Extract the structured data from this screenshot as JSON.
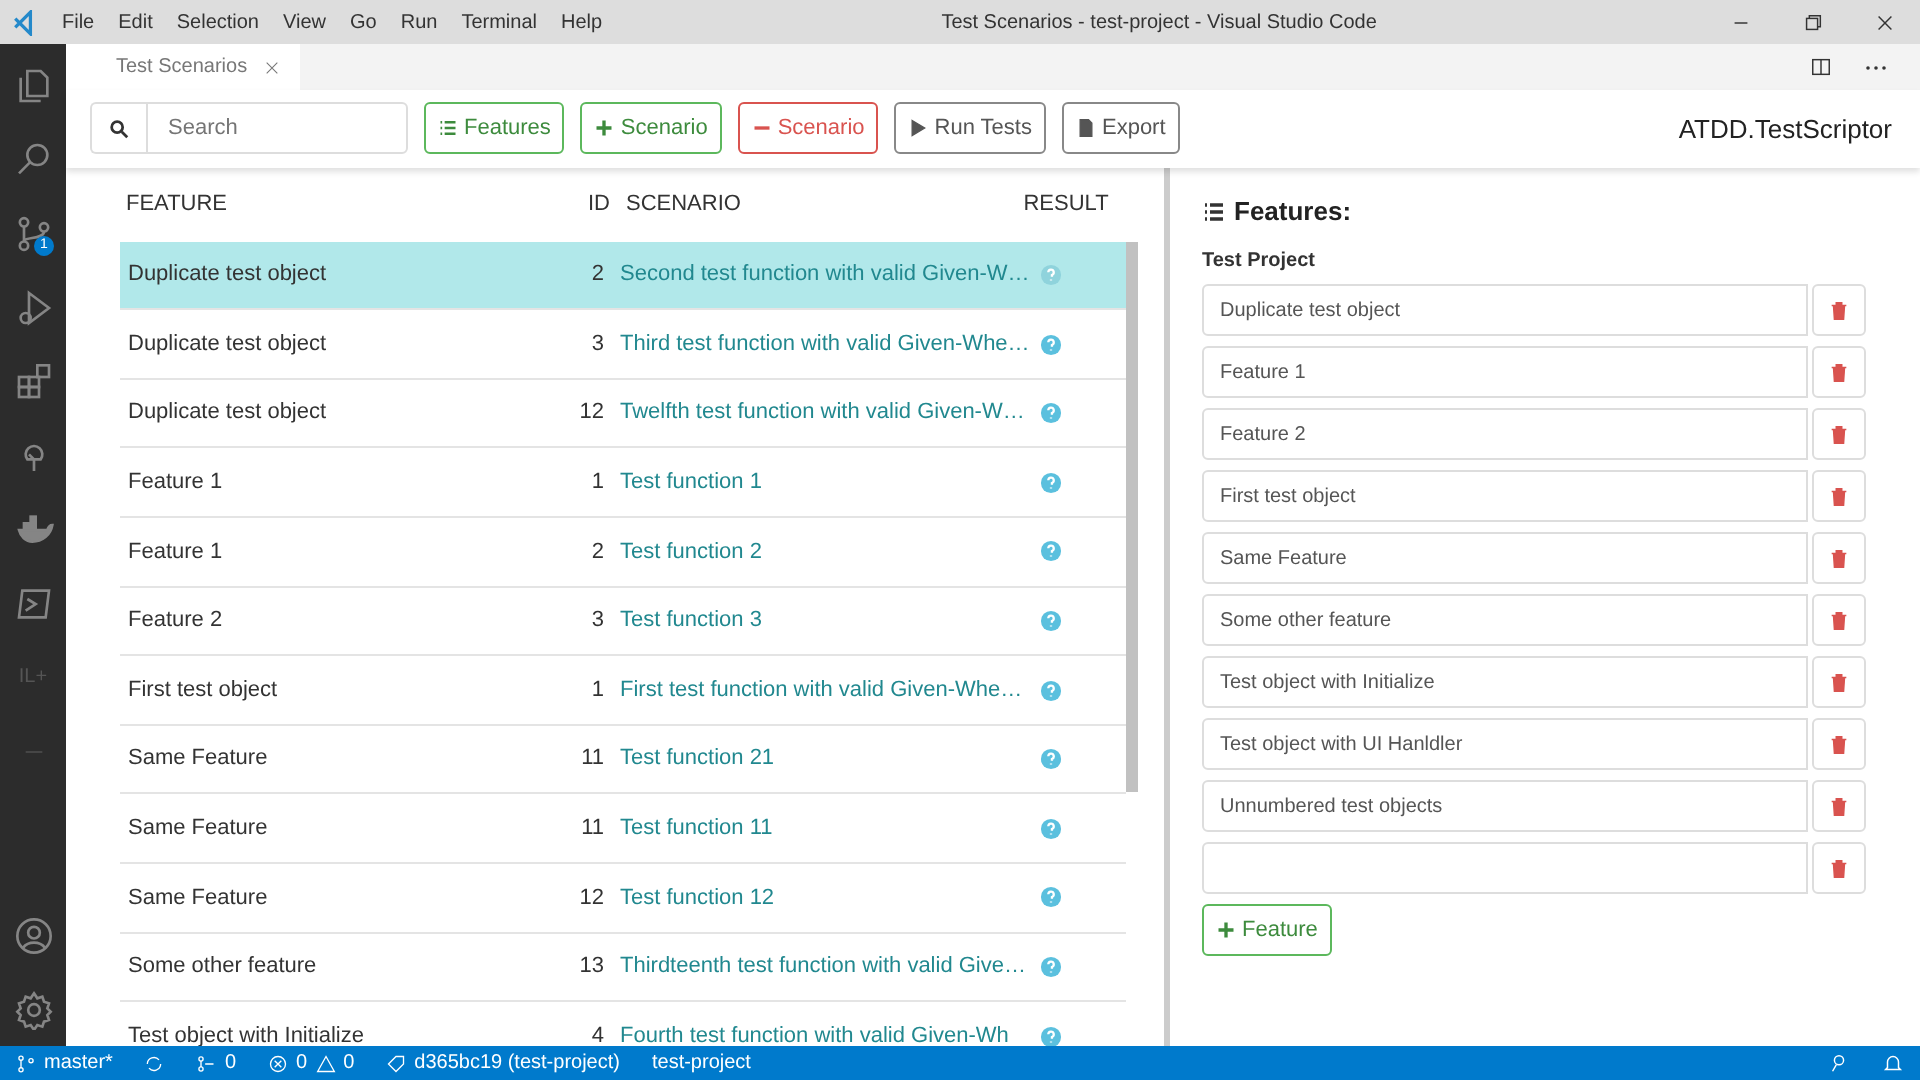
{
  "window": {
    "title": "Test Scenarios - test-project - Visual Studio Code",
    "menu": [
      "File",
      "Edit",
      "Selection",
      "View",
      "Go",
      "Run",
      "Terminal",
      "Help"
    ]
  },
  "activity_bar": {
    "source_control_badge": "1",
    "extension_label": "IL+"
  },
  "editor_tab": {
    "label": "Test Scenarios"
  },
  "toolbar": {
    "search": {
      "placeholder": "Search"
    },
    "buttons": [
      {
        "kind": "features",
        "label": "Features"
      },
      {
        "kind": "add",
        "label": "Scenario"
      },
      {
        "kind": "remove",
        "label": "Scenario"
      },
      {
        "kind": "run",
        "label": "Run Tests"
      },
      {
        "kind": "export",
        "label": "Export"
      }
    ],
    "brand": "ATDD.TestScriptor"
  },
  "table": {
    "columns": [
      "FEATURE",
      "ID",
      "SCENARIO",
      "RESULT"
    ],
    "rows": [
      {
        "feature": "Duplicate test object",
        "id": "2",
        "scenario": "Second test function with valid Given-W…",
        "selected": true
      },
      {
        "feature": "Duplicate test object",
        "id": "3",
        "scenario": "Third test function with valid Given-Whe…",
        "selected": false
      },
      {
        "feature": "Duplicate test object",
        "id": "12",
        "scenario": "Twelfth test function with valid Given-W…",
        "selected": false
      },
      {
        "feature": "Feature 1",
        "id": "1",
        "scenario": "Test function 1",
        "selected": false
      },
      {
        "feature": "Feature 1",
        "id": "2",
        "scenario": "Test function 2",
        "selected": false
      },
      {
        "feature": "Feature 2",
        "id": "3",
        "scenario": "Test function 3",
        "selected": false
      },
      {
        "feature": "First test object",
        "id": "1",
        "scenario": "First test function with valid Given-Whe…",
        "selected": false
      },
      {
        "feature": "Same Feature",
        "id": "11",
        "scenario": "Test function 21",
        "selected": false
      },
      {
        "feature": "Same Feature",
        "id": "11",
        "scenario": "Test function 11",
        "selected": false
      },
      {
        "feature": "Same Feature",
        "id": "12",
        "scenario": "Test function 12",
        "selected": false
      },
      {
        "feature": "Some other feature",
        "id": "13",
        "scenario": "Thirdteenth test function with valid Give…",
        "selected": false
      },
      {
        "feature": "Test object with Initialize",
        "id": "4",
        "scenario": "Fourth test function with valid Given-Wh",
        "selected": false
      }
    ]
  },
  "features_panel": {
    "title": "Features:",
    "project": "Test Project",
    "features": [
      "Duplicate test object",
      "Feature 1",
      "Feature 2",
      "First test object",
      "Same Feature",
      "Some other feature",
      "Test object with Initialize",
      "Test object with UI Hanldler",
      "Unnumbered test objects"
    ],
    "new_feature_field": true,
    "add_button": "Feature"
  },
  "status_bar": {
    "branch": "master*",
    "pull_requests": "0",
    "errors": "0",
    "warnings": "0",
    "commit": "d365bc19 (test-project)",
    "project": "test-project"
  }
}
